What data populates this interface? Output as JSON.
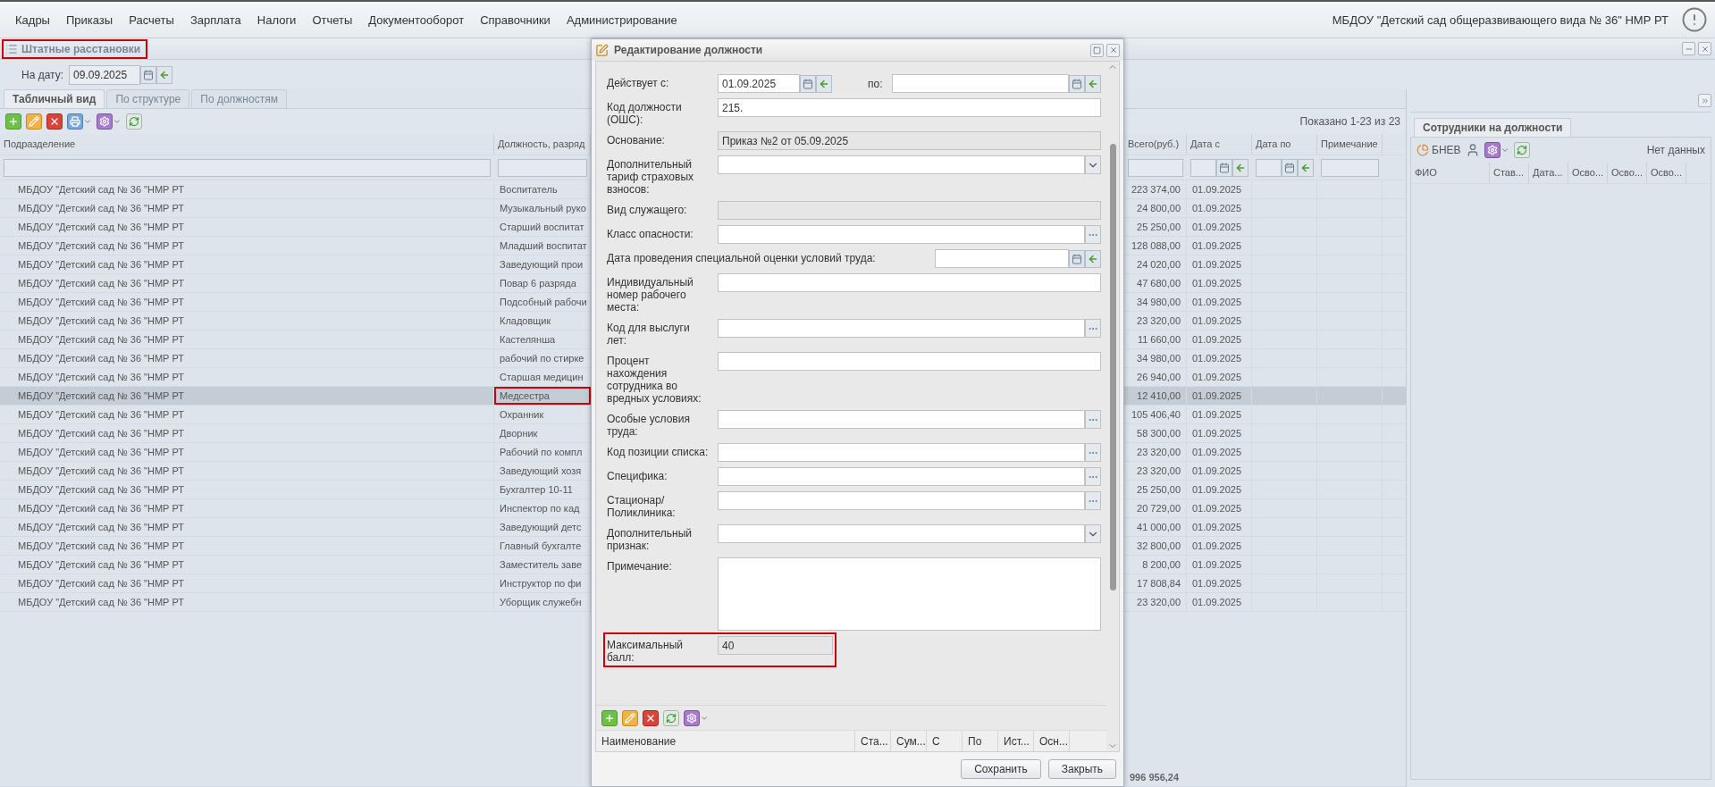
{
  "menu": {
    "items": [
      "Кадры",
      "Приказы",
      "Расчеты",
      "Зарплата",
      "Налоги",
      "Отчеты",
      "Документооборот",
      "Справочники",
      "Администрирование"
    ],
    "organization": "МБДОУ \"Детский сад общеразвивающего вида № 36\" НМР РТ"
  },
  "panel": {
    "title": "Штатные расстановки",
    "highlighted": true,
    "date_label": "На дату:",
    "date_value": "09.09.2025",
    "tabs": [
      {
        "label": "Табличный вид",
        "selected": true
      },
      {
        "label": "По структуре",
        "selected": false
      },
      {
        "label": "По должностям",
        "selected": false
      }
    ],
    "paging": "Показано 1-23 из 23",
    "table": {
      "columns": [
        {
          "label": "Подразделение",
          "kind": "text"
        },
        {
          "label": "Должность, разряд",
          "kind": "text"
        },
        {
          "label": "Всего(руб.)",
          "kind": "money"
        },
        {
          "label": "Дата с",
          "kind": "date"
        },
        {
          "label": "Дата по",
          "kind": "date"
        },
        {
          "label": "Примечание",
          "kind": "text"
        }
      ],
      "rows": [
        {
          "cells": [
            "МБДОУ \"Детский сад № 36 \"НМР РТ",
            "Воспитатель",
            "223 374,00",
            "01.09.2025"
          ],
          "selected": false,
          "marked": false
        },
        {
          "cells": [
            "МБДОУ \"Детский сад № 36 \"НМР РТ",
            "Музыкальный руко",
            "24 800,00",
            "01.09.2025"
          ],
          "selected": false,
          "marked": false
        },
        {
          "cells": [
            "МБДОУ \"Детский сад № 36 \"НМР РТ",
            "Старший воспитат",
            "25 250,00",
            "01.09.2025"
          ],
          "selected": false,
          "marked": false
        },
        {
          "cells": [
            "МБДОУ \"Детский сад № 36 \"НМР РТ",
            "Младший воспитат",
            "128 088,00",
            "01.09.2025"
          ],
          "selected": false,
          "marked": false
        },
        {
          "cells": [
            "МБДОУ \"Детский сад № 36 \"НМР РТ",
            "Заведующий прои",
            "24 020,00",
            "01.09.2025"
          ],
          "selected": false,
          "marked": false
        },
        {
          "cells": [
            "МБДОУ \"Детский сад № 36 \"НМР РТ",
            "Повар 6 разряда",
            "47 680,00",
            "01.09.2025"
          ],
          "selected": false,
          "marked": false
        },
        {
          "cells": [
            "МБДОУ \"Детский сад № 36 \"НМР РТ",
            "Подсобный рабочи",
            "34 980,00",
            "01.09.2025"
          ],
          "selected": false,
          "marked": false
        },
        {
          "cells": [
            "МБДОУ \"Детский сад № 36 \"НМР РТ",
            "Кладовщик",
            "23 320,00",
            "01.09.2025"
          ],
          "selected": false,
          "marked": false
        },
        {
          "cells": [
            "МБДОУ \"Детский сад № 36 \"НМР РТ",
            "Кастелянша",
            "11 660,00",
            "01.09.2025"
          ],
          "selected": false,
          "marked": false
        },
        {
          "cells": [
            "МБДОУ \"Детский сад № 36 \"НМР РТ",
            "рабочий по стирке",
            "34 980,00",
            "01.09.2025"
          ],
          "selected": false,
          "marked": false
        },
        {
          "cells": [
            "МБДОУ \"Детский сад № 36 \"НМР РТ",
            "Старшая медицин",
            "26 940,00",
            "01.09.2025"
          ],
          "selected": false,
          "marked": false
        },
        {
          "cells": [
            "МБДОУ \"Детский сад № 36 \"НМР РТ",
            "Медсестра",
            "12 410,00",
            "01.09.2025"
          ],
          "selected": true,
          "marked": true
        },
        {
          "cells": [
            "МБДОУ \"Детский сад № 36 \"НМР РТ",
            "Охранник",
            "105 406,40",
            "01.09.2025"
          ],
          "selected": false,
          "marked": false
        },
        {
          "cells": [
            "МБДОУ \"Детский сад № 36 \"НМР РТ",
            "Дворник",
            "58 300,00",
            "01.09.2025"
          ],
          "selected": false,
          "marked": false
        },
        {
          "cells": [
            "МБДОУ \"Детский сад № 36 \"НМР РТ",
            "Рабочий по компл",
            "23 320,00",
            "01.09.2025"
          ],
          "selected": false,
          "marked": false
        },
        {
          "cells": [
            "МБДОУ \"Детский сад № 36 \"НМР РТ",
            "Заведующий хозя",
            "23 320,00",
            "01.09.2025"
          ],
          "selected": false,
          "marked": false
        },
        {
          "cells": [
            "МБДОУ \"Детский сад № 36 \"НМР РТ",
            "Бухгалтер 10-11",
            "25 250,00",
            "01.09.2025"
          ],
          "selected": false,
          "marked": false
        },
        {
          "cells": [
            "МБДОУ \"Детский сад № 36 \"НМР РТ",
            "Инспектор по кад",
            "20 729,00",
            "01.09.2025"
          ],
          "selected": false,
          "marked": false
        },
        {
          "cells": [
            "МБДОУ \"Детский сад № 36 \"НМР РТ",
            "Заведующий детс",
            "41 000,00",
            "01.09.2025"
          ],
          "selected": false,
          "marked": false
        },
        {
          "cells": [
            "МБДОУ \"Детский сад № 36 \"НМР РТ",
            "Главный бухгалте",
            "32 800,00",
            "01.09.2025"
          ],
          "selected": false,
          "marked": false
        },
        {
          "cells": [
            "МБДОУ \"Детский сад № 36 \"НМР РТ",
            "Заместитель заве",
            "8 200,00",
            "01.09.2025"
          ],
          "selected": false,
          "marked": false
        },
        {
          "cells": [
            "МБДОУ \"Детский сад № 36 \"НМР РТ",
            "Инструктор по фи",
            "17 808,84",
            "01.09.2025"
          ],
          "selected": false,
          "marked": false
        },
        {
          "cells": [
            "МБДОУ \"Детский сад № 36 \"НМР РТ",
            "Уборщик служебн",
            "23 320,00",
            "01.09.2025"
          ],
          "selected": false,
          "marked": false
        }
      ],
      "total": "996 956,24"
    }
  },
  "side_panel": {
    "tabs": [
      {
        "label": "Сотрудники на должности",
        "selected": true
      }
    ],
    "toolbar_label": "БНЕВ",
    "status": "Нет данных",
    "columns": [
      "ФИО",
      "Став...",
      "Дата...",
      "Осво...",
      "Осво...",
      "Осво..."
    ]
  },
  "dialog": {
    "title": "Редактирование должности",
    "fields": [
      {
        "kind": "date_range",
        "label": "Действует с:",
        "value": "01.09.2025",
        "to_label": "по:"
      },
      {
        "kind": "text",
        "label": "Код должности (ОШС):",
        "value": "215."
      },
      {
        "kind": "readonly",
        "label": "Основание:",
        "value": "Приказ №2 от 05.09.2025"
      },
      {
        "kind": "select",
        "label": "Дополнительный тариф страховых взносов:"
      },
      {
        "kind": "readonly",
        "label": "Вид служащего:"
      },
      {
        "kind": "lookup",
        "label": "Класс опасности:"
      },
      {
        "kind": "date",
        "label": "Дата проведения специальной оценки условий труда:"
      },
      {
        "kind": "text",
        "label": "Индивидуальный номер рабочего места:"
      },
      {
        "kind": "lookup",
        "label": "Код для выслуги лет:"
      },
      {
        "kind": "text",
        "label": "Процент нахождения сотрудника во вредных условиях:"
      },
      {
        "kind": "lookup",
        "label": "Особые условия труда:"
      },
      {
        "kind": "lookup",
        "label": "Код позиции списка:"
      },
      {
        "kind": "lookup",
        "label": "Специфика:"
      },
      {
        "kind": "lookup",
        "label": "Стационар/ Поликлиника:"
      },
      {
        "kind": "select",
        "label": "Дополнительный признак:"
      },
      {
        "kind": "textarea",
        "label": "Примечание:"
      },
      {
        "kind": "readonly",
        "label": "Максимальный балл:",
        "value": "40",
        "marked": true
      }
    ],
    "subgrid_columns": [
      "Наименование",
      "Ста...",
      "Сум...",
      "С",
      "По",
      "Ист...",
      "Осн..."
    ],
    "buttons": [
      "Сохранить",
      "Закрыть"
    ]
  }
}
